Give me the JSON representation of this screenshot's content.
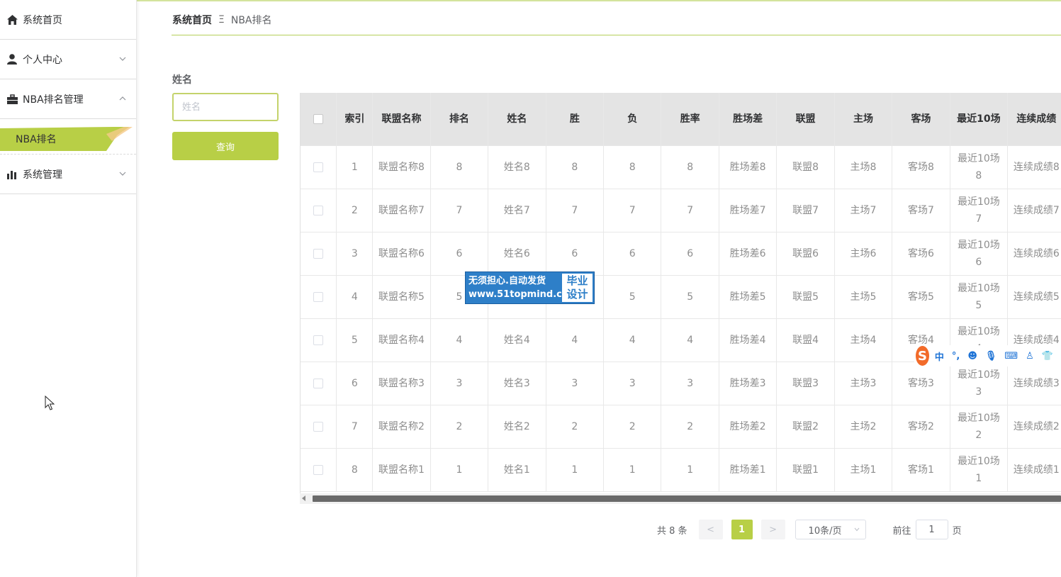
{
  "sidebar": {
    "items": [
      {
        "label": "系统首页",
        "icon": "home-icon"
      },
      {
        "label": "个人中心",
        "icon": "user-icon"
      },
      {
        "label": "NBA排名管理",
        "icon": "briefcase-icon"
      },
      {
        "label": "系统管理",
        "icon": "bar-chart-icon"
      }
    ],
    "sub_item": "NBA排名"
  },
  "breadcrumb": {
    "home": "系统首页",
    "separator": "Ξ",
    "current": "NBA排名"
  },
  "search": {
    "label": "姓名",
    "placeholder": "姓名",
    "value": "",
    "button": "查询"
  },
  "table": {
    "columns": [
      "索引",
      "联盟名称",
      "排名",
      "姓名",
      "胜",
      "负",
      "胜率",
      "胜场差",
      "联盟",
      "主场",
      "客场",
      "最近10场",
      "连续成绩"
    ],
    "rows": [
      [
        "1",
        "联盟名称8",
        "8",
        "姓名8",
        "8",
        "8",
        "8",
        "胜场差8",
        "联盟8",
        "主场8",
        "客场8",
        "最近10场8",
        "连续成绩8"
      ],
      [
        "2",
        "联盟名称7",
        "7",
        "姓名7",
        "7",
        "7",
        "7",
        "胜场差7",
        "联盟7",
        "主场7",
        "客场7",
        "最近10场7",
        "连续成绩7"
      ],
      [
        "3",
        "联盟名称6",
        "6",
        "姓名6",
        "6",
        "6",
        "6",
        "胜场差6",
        "联盟6",
        "主场6",
        "客场6",
        "最近10场6",
        "连续成绩6"
      ],
      [
        "4",
        "联盟名称5",
        "5",
        "姓名5",
        "5",
        "5",
        "5",
        "胜场差5",
        "联盟5",
        "主场5",
        "客场5",
        "最近10场5",
        "连续成绩5"
      ],
      [
        "5",
        "联盟名称4",
        "4",
        "姓名4",
        "4",
        "4",
        "4",
        "胜场差4",
        "联盟4",
        "主场4",
        "客场4",
        "最近10场4",
        "连续成绩4"
      ],
      [
        "6",
        "联盟名称3",
        "3",
        "姓名3",
        "3",
        "3",
        "3",
        "胜场差3",
        "联盟3",
        "主场3",
        "客场3",
        "最近10场3",
        "连续成绩3"
      ],
      [
        "7",
        "联盟名称2",
        "2",
        "姓名2",
        "2",
        "2",
        "2",
        "胜场差2",
        "联盟2",
        "主场2",
        "客场2",
        "最近10场2",
        "连续成绩2"
      ],
      [
        "8",
        "联盟名称1",
        "1",
        "姓名1",
        "1",
        "1",
        "1",
        "胜场差1",
        "联盟1",
        "主场1",
        "客场1",
        "最近10场1",
        "连续成绩1"
      ]
    ]
  },
  "pagination": {
    "total": "共 8 条",
    "prev": "<",
    "current": "1",
    "next": ">",
    "page_size": "10条/页",
    "goto_label": "前往",
    "goto_value": "1",
    "goto_suffix": "页"
  },
  "watermark": {
    "line1": "无须担心.自动发货",
    "line2": "www.51topmind.com",
    "right1": "毕业",
    "right2": "设计"
  },
  "ime_toolbar": {
    "logo": "S",
    "mode": "中",
    "punct": "°,"
  },
  "colors": {
    "accent": "#b8cf46",
    "header_bg": "#e4e4e4",
    "watermark": "#2e7fc8"
  }
}
